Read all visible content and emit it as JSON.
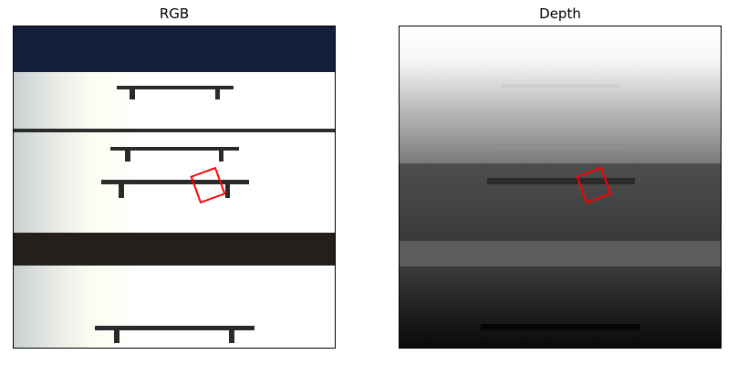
{
  "panels": [
    {
      "id": "rgb",
      "title": "RGB"
    },
    {
      "id": "depth",
      "title": "Depth"
    }
  ],
  "colors": {
    "grasp_box": "#ff0000",
    "rgb_sky": "#13203d",
    "rgb_dark_band": "#231f1b",
    "depth_far": "#ffffff",
    "depth_near": "#000000"
  }
}
